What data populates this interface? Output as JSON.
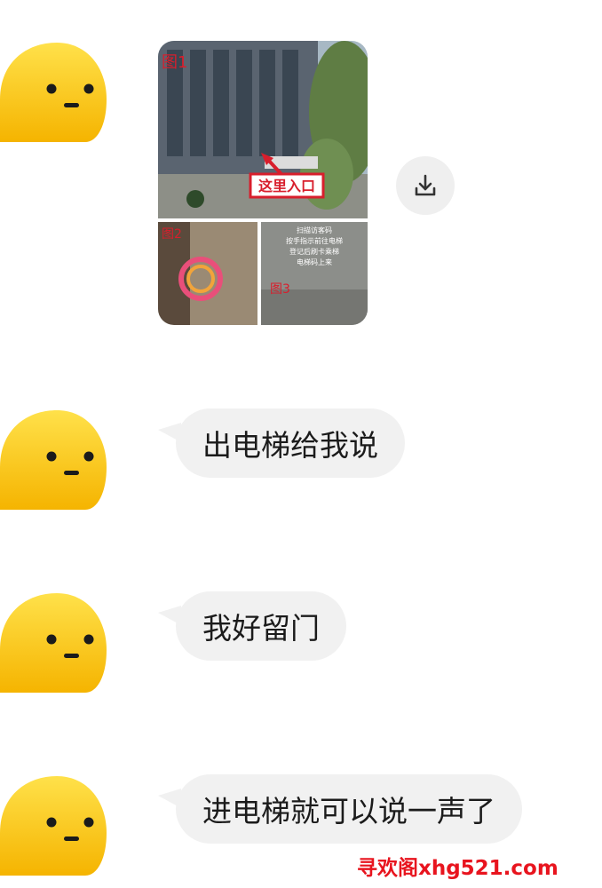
{
  "messages": [
    {
      "type": "image",
      "annotations": {
        "label_1": "图1",
        "entrance_label": "这里入口",
        "label_2": "图2",
        "label_3": "图3",
        "sign_text_1": "扫描访客码",
        "sign_text_2": "按手指示前往电梯",
        "sign_text_3": "登记后刷卡乘梯",
        "sign_text_4": "电梯码上来"
      }
    },
    {
      "type": "text",
      "text": "出电梯给我说"
    },
    {
      "type": "text",
      "text": "我好留门"
    },
    {
      "type": "text",
      "text": "进电梯就可以说一声了"
    }
  ],
  "icons": {
    "avatar": "yellow-blob-face-icon",
    "download": "download-icon"
  },
  "colors": {
    "avatar_yellow": "#ffd21f",
    "bubble_bg": "#f1f1f1",
    "watermark": "#e8141e",
    "annotation_red": "#d81e2c"
  },
  "watermark": "寻欢阁xhg521.com"
}
